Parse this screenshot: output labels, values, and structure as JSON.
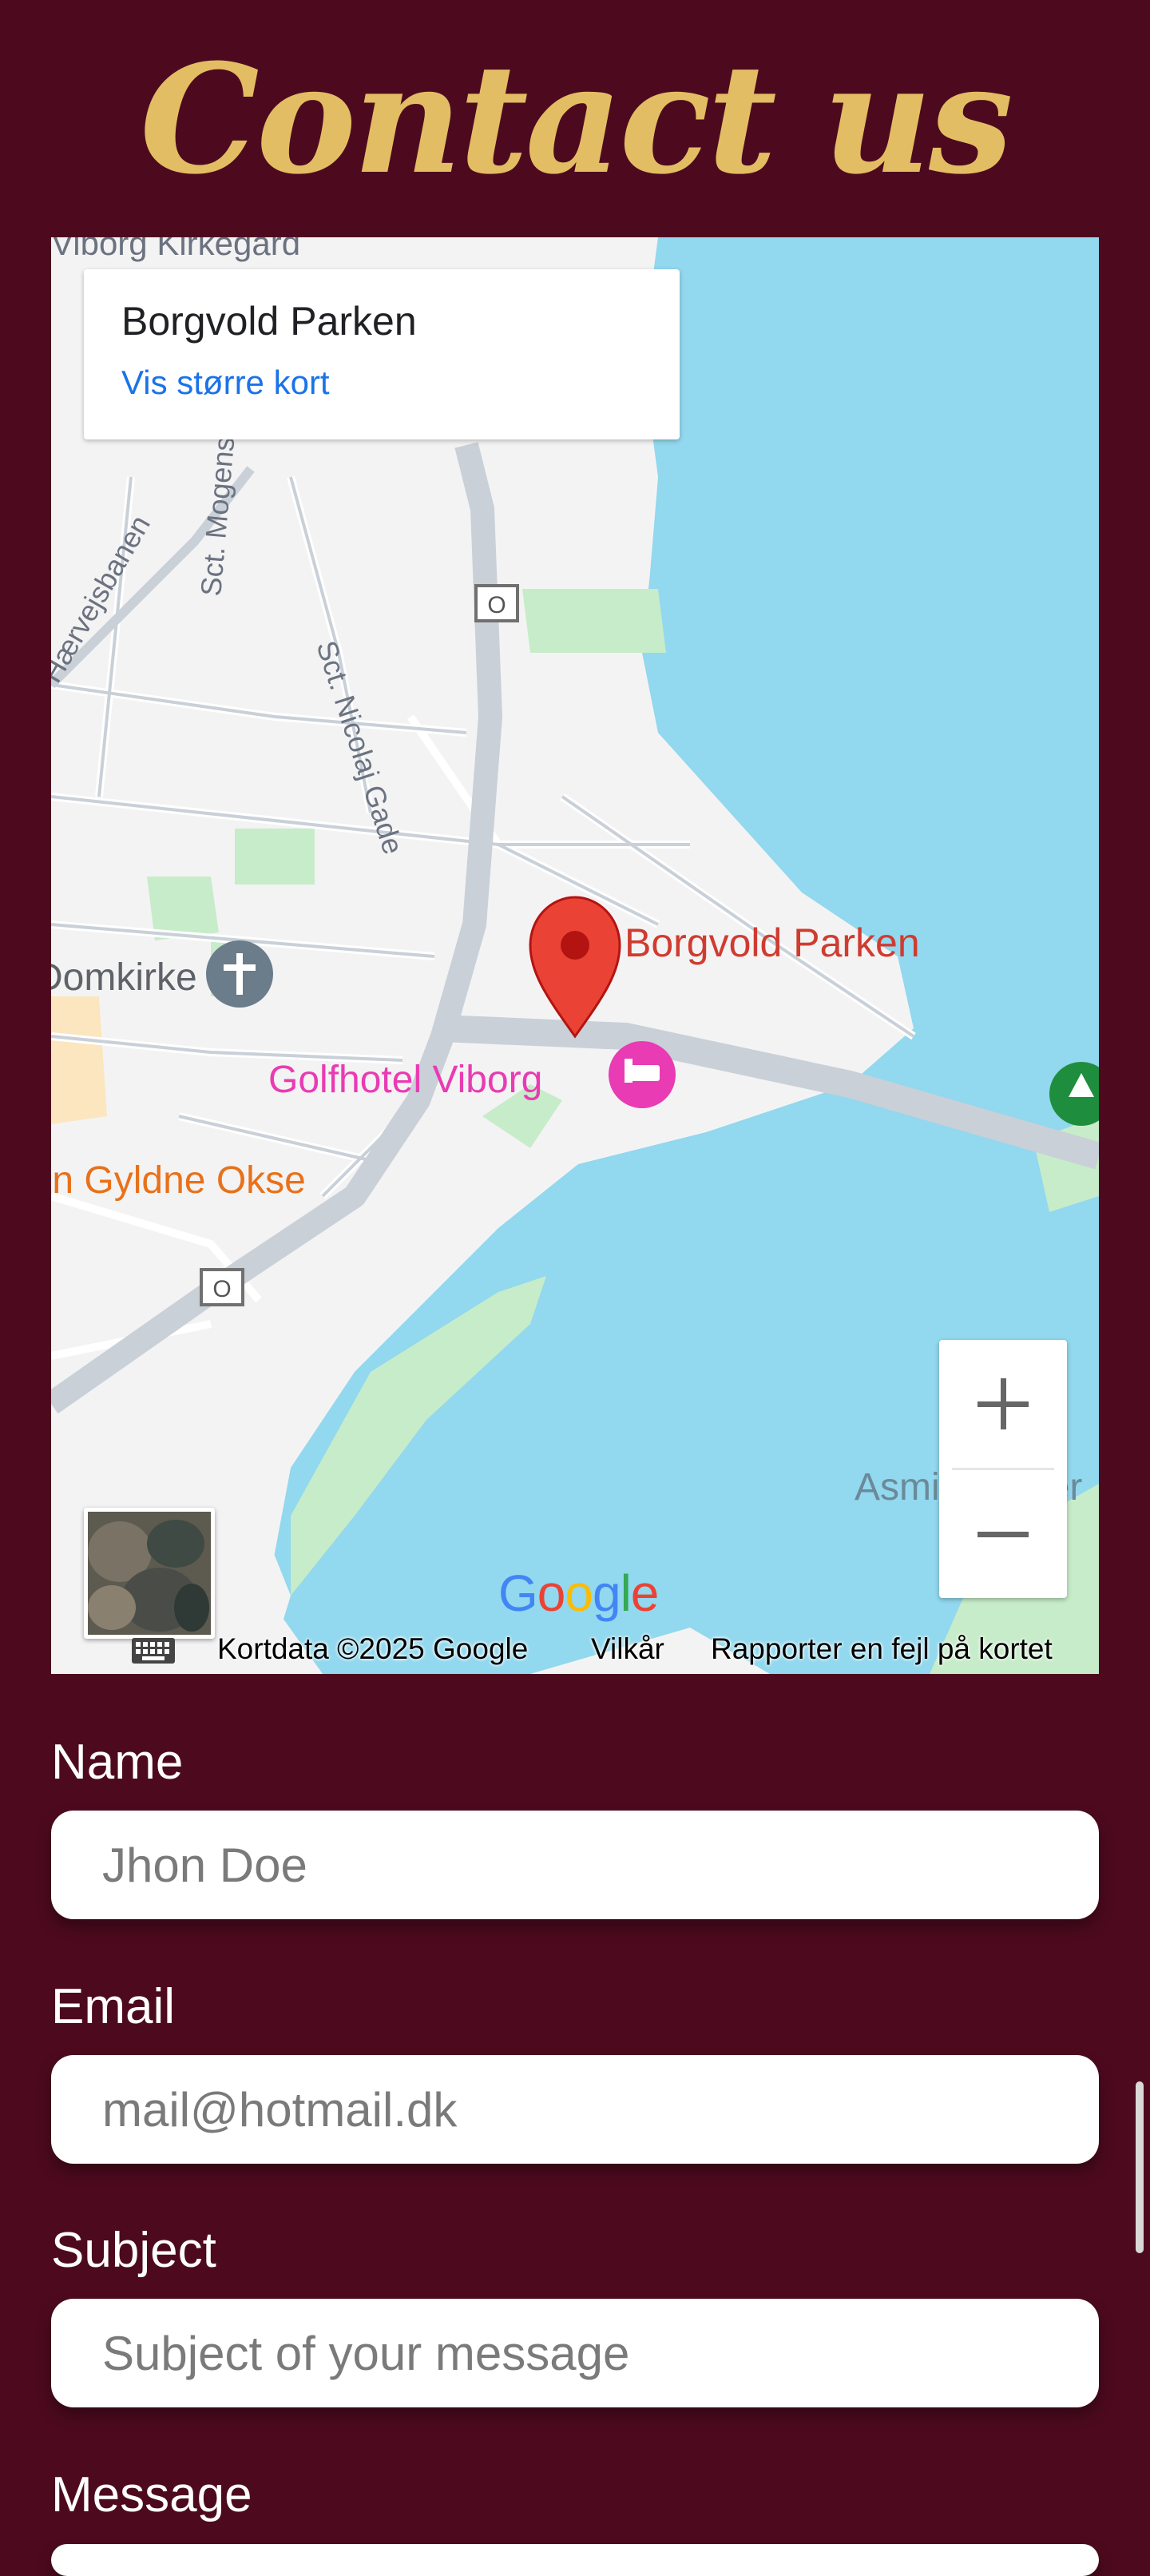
{
  "header": {
    "title": "Contact us"
  },
  "map": {
    "info_card": {
      "place_name": "Borgvold Parken",
      "larger_map_link": "Vis større kort"
    },
    "labels": {
      "cemetery": "Viborg Kirkegård",
      "street_mogensgade": "Sct. Mogensgade",
      "street_nicolaj": "Sct. Nicolaj Gade",
      "railway": "Hærvejsbanen",
      "church": "Domkirke",
      "hotel": "Golfhotel Viborg",
      "restaurant": "Den Gyldne Okse",
      "marker": "Borgvold Parken",
      "lake": "Asmildkloster"
    },
    "road_badge_1": "O",
    "road_badge_2": "O",
    "google_logo": "Google",
    "attribution": {
      "copyright": "Kortdata ©2025 Google",
      "terms": "Vilkår",
      "report": "Rapporter en fejl på kortet"
    },
    "colors": {
      "water": "#92d8ee",
      "land": "#f4f3f4",
      "park": "#c7ecc9",
      "road": "#c9d0d8",
      "marker": "#ea4335",
      "hotel": "#e93bb3"
    }
  },
  "form": {
    "name": {
      "label": "Name",
      "placeholder": "Jhon Doe"
    },
    "email": {
      "label": "Email",
      "placeholder": "mail@hotmail.dk"
    },
    "subject": {
      "label": "Subject",
      "placeholder": "Subject of your message"
    },
    "message": {
      "label": "Message"
    }
  },
  "theme": {
    "background": "#4d0a1f",
    "title_color": "#e3bd63",
    "label_color": "#ffffff",
    "input_background": "#ffffff"
  }
}
